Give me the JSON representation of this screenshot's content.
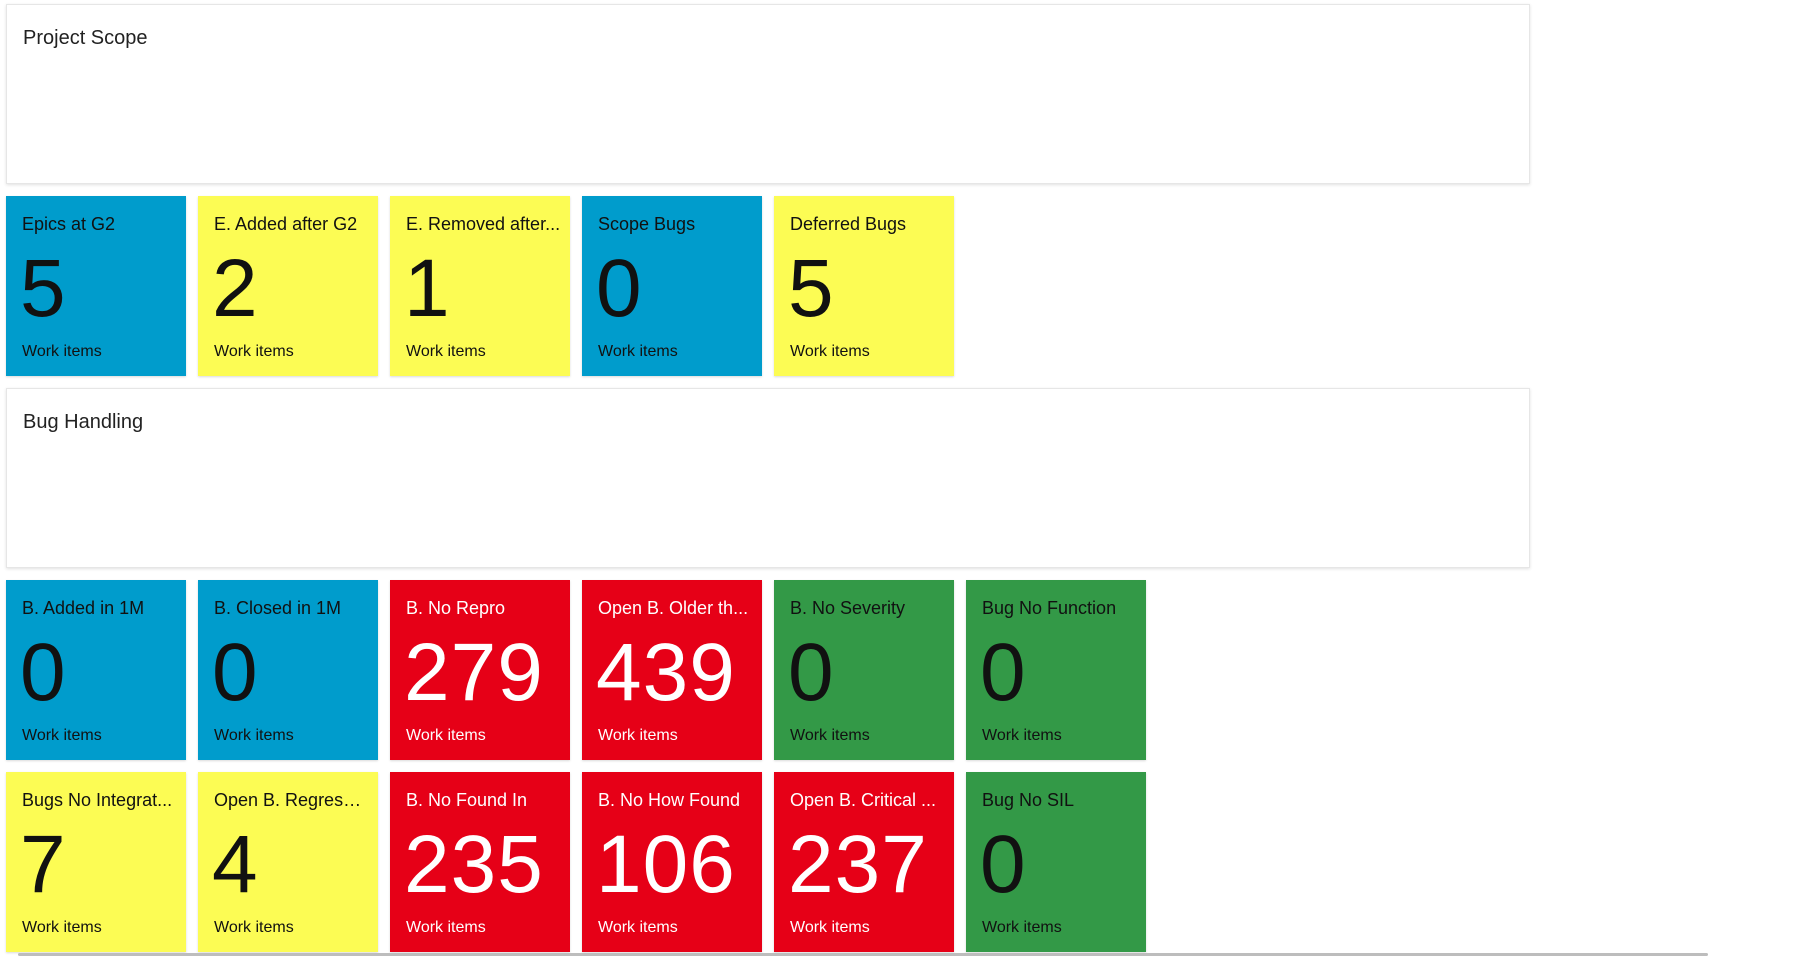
{
  "colors": {
    "blue": "#009ccc",
    "yellow": "#fcfc54",
    "red": "#e60017",
    "green": "#339947"
  },
  "sections": {
    "project_scope": {
      "title": "Project Scope"
    },
    "bug_handling": {
      "title": "Bug Handling"
    }
  },
  "scope_tiles": [
    {
      "title": "Epics at G2",
      "count": "5",
      "sub": "Work items",
      "color": "blue"
    },
    {
      "title": "E. Added after G2",
      "count": "2",
      "sub": "Work items",
      "color": "yellow"
    },
    {
      "title": "E. Removed after...",
      "count": "1",
      "sub": "Work items",
      "color": "yellow"
    },
    {
      "title": "Scope Bugs",
      "count": "0",
      "sub": "Work items",
      "color": "blue"
    },
    {
      "title": "Deferred Bugs",
      "count": "5",
      "sub": "Work items",
      "color": "yellow"
    }
  ],
  "bug_tiles_row1": [
    {
      "title": "B. Added in 1M",
      "count": "0",
      "sub": "Work items",
      "color": "blue"
    },
    {
      "title": "B. Closed in 1M",
      "count": "0",
      "sub": "Work items",
      "color": "blue"
    },
    {
      "title": "B. No Repro",
      "count": "279",
      "sub": "Work items",
      "color": "red"
    },
    {
      "title": "Open B. Older th...",
      "count": "439",
      "sub": "Work items",
      "color": "red"
    },
    {
      "title": "B. No Severity",
      "count": "0",
      "sub": "Work items",
      "color": "green"
    },
    {
      "title": "Bug No Function",
      "count": "0",
      "sub": "Work items",
      "color": "green"
    }
  ],
  "bug_tiles_row2": [
    {
      "title": "Bugs No Integrat...",
      "count": "7",
      "sub": "Work items",
      "color": "yellow"
    },
    {
      "title": "Open B. Regressi...",
      "count": "4",
      "sub": "Work items",
      "color": "yellow"
    },
    {
      "title": "B. No Found In",
      "count": "235",
      "sub": "Work items",
      "color": "red"
    },
    {
      "title": "B. No How Found",
      "count": "106",
      "sub": "Work items",
      "color": "red"
    },
    {
      "title": "Open B. Critical ...",
      "count": "237",
      "sub": "Work items",
      "color": "red"
    },
    {
      "title": "Bug No SIL",
      "count": "0",
      "sub": "Work items",
      "color": "green"
    }
  ]
}
